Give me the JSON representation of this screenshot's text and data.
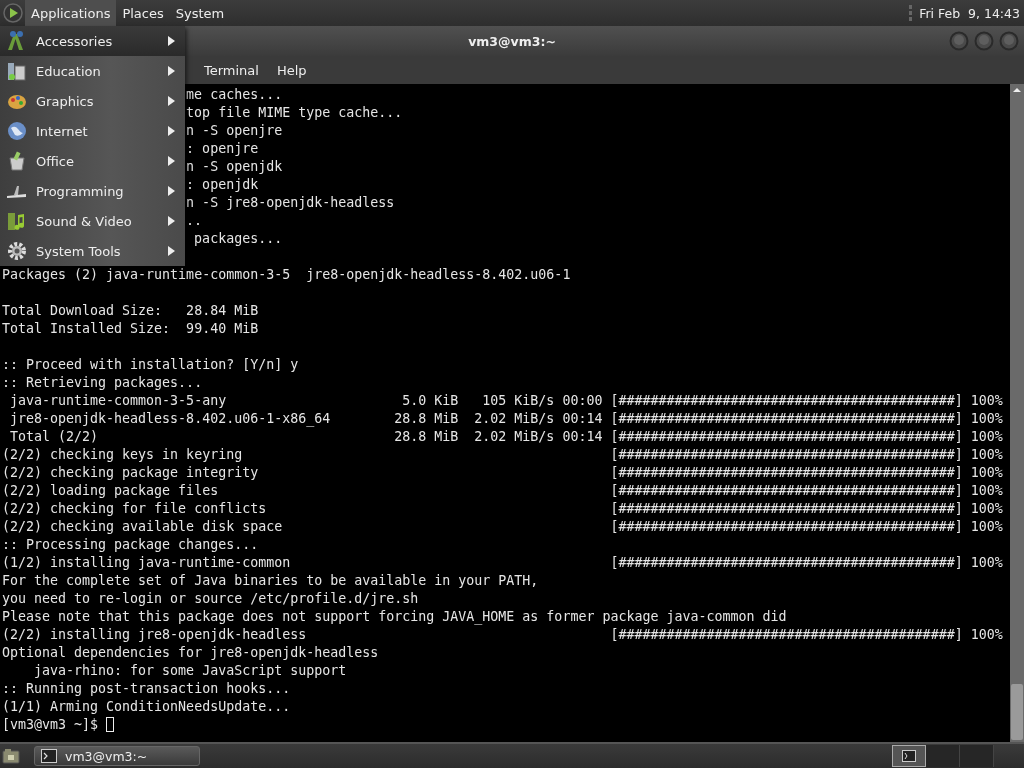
{
  "top_panel": {
    "menus": [
      {
        "label": "Applications",
        "selected": true
      },
      {
        "label": "Places",
        "selected": false
      },
      {
        "label": "System",
        "selected": false
      }
    ],
    "clock": "Fri Feb  9, 14:43"
  },
  "applications_menu": {
    "items": [
      {
        "label": "Accessories",
        "selected": true
      },
      {
        "label": "Education",
        "selected": false
      },
      {
        "label": "Graphics",
        "selected": false
      },
      {
        "label": "Internet",
        "selected": false
      },
      {
        "label": "Office",
        "selected": false
      },
      {
        "label": "Programming",
        "selected": false
      },
      {
        "label": "Sound & Video",
        "selected": false
      },
      {
        "label": "System Tools",
        "selected": false
      }
    ]
  },
  "window": {
    "title": "vm3@vm3:~",
    "menu": [
      "Terminal",
      "Help"
    ]
  },
  "terminal": {
    "lines": [
      {
        "kind": "covered",
        "text": "me caches..."
      },
      {
        "kind": "covered",
        "text": "top file MIME type cache..."
      },
      {
        "kind": "covered",
        "text": "n -S openjre"
      },
      {
        "kind": "covered",
        "text": ": openjre"
      },
      {
        "kind": "covered",
        "text": "n -S openjdk"
      },
      {
        "kind": "covered",
        "text": ": openjdk"
      },
      {
        "kind": "covered",
        "text": "n -S jre8-openjdk-headless"
      },
      {
        "kind": "covered",
        "text": ".."
      },
      {
        "kind": "covered",
        "text": " packages..."
      },
      {
        "kind": "blank"
      },
      {
        "kind": "text",
        "text": "Packages (2) java-runtime-common-3-5  jre8-openjdk-headless-8.402.u06-1"
      },
      {
        "kind": "blank"
      },
      {
        "kind": "text",
        "text": "Total Download Size:   28.84 MiB"
      },
      {
        "kind": "text",
        "text": "Total Installed Size:  99.40 MiB"
      },
      {
        "kind": "blank"
      },
      {
        "kind": "text",
        "text": ":: Proceed with installation? [Y/n] y"
      },
      {
        "kind": "text",
        "text": ":: Retrieving packages..."
      },
      {
        "kind": "download",
        "name": " java-runtime-common-3-5-any",
        "size": "5.0 KiB",
        "rate": "105 KiB/s",
        "time": "00:00",
        "bar": "[##########################################]",
        "percent": "100%"
      },
      {
        "kind": "download",
        "name": " jre8-openjdk-headless-8.402.u06-1-x86_64",
        "size": "28.8 MiB",
        "rate": "2.02 MiB/s",
        "time": "00:14",
        "bar": "[##########################################]",
        "percent": "100%"
      },
      {
        "kind": "download",
        "name": " Total (2/2)",
        "size": "28.8 MiB",
        "rate": "2.02 MiB/s",
        "time": "00:14",
        "bar": "[##########################################]",
        "percent": "100%"
      },
      {
        "kind": "progress",
        "label": "(2/2) checking keys in keyring",
        "bar": "[##########################################]",
        "percent": "100%"
      },
      {
        "kind": "progress",
        "label": "(2/2) checking package integrity",
        "bar": "[##########################################]",
        "percent": "100%"
      },
      {
        "kind": "progress",
        "label": "(2/2) loading package files",
        "bar": "[##########################################]",
        "percent": "100%"
      },
      {
        "kind": "progress",
        "label": "(2/2) checking for file conflicts",
        "bar": "[##########################################]",
        "percent": "100%"
      },
      {
        "kind": "progress",
        "label": "(2/2) checking available disk space",
        "bar": "[##########################################]",
        "percent": "100%"
      },
      {
        "kind": "text",
        "text": ":: Processing package changes..."
      },
      {
        "kind": "progress",
        "label": "(1/2) installing java-runtime-common",
        "bar": "[##########################################]",
        "percent": "100%"
      },
      {
        "kind": "text",
        "text": "For the complete set of Java binaries to be available in your PATH,"
      },
      {
        "kind": "text",
        "text": "you need to re-login or source /etc/profile.d/jre.sh"
      },
      {
        "kind": "text",
        "text": "Please note that this package does not support forcing JAVA_HOME as former package java-common did"
      },
      {
        "kind": "progress",
        "label": "(2/2) installing jre8-openjdk-headless",
        "bar": "[##########################################]",
        "percent": "100%"
      },
      {
        "kind": "text",
        "text": "Optional dependencies for jre8-openjdk-headless"
      },
      {
        "kind": "text",
        "text": "    java-rhino: for some JavaScript support"
      },
      {
        "kind": "text",
        "text": ":: Running post-transaction hooks..."
      },
      {
        "kind": "text",
        "text": "(1/1) Arming ConditionNeedsUpdate..."
      },
      {
        "kind": "prompt",
        "text": "[vm3@vm3 ~]$"
      }
    ]
  },
  "taskbar": {
    "tasks": [
      {
        "label": "vm3@vm3:~"
      }
    ]
  }
}
